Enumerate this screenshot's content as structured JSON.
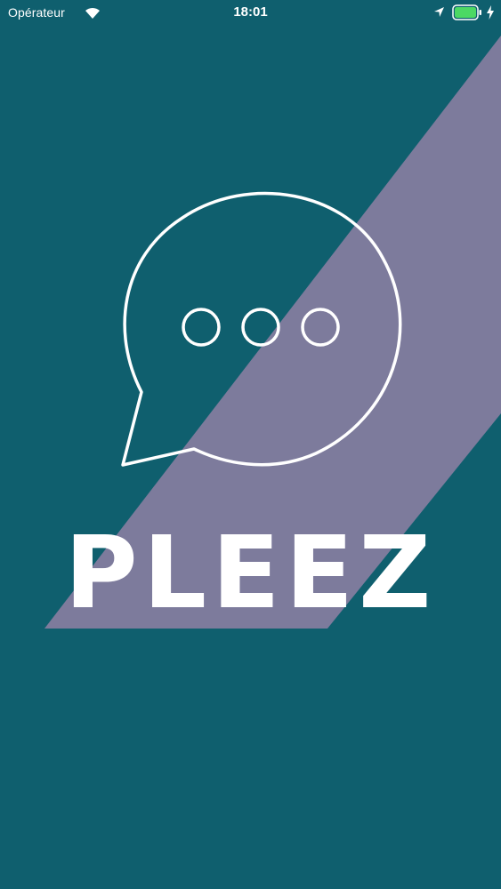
{
  "status_bar": {
    "carrier": "Opérateur",
    "time": "18:01",
    "icons": [
      "wifi-icon",
      "location-icon",
      "battery-icon",
      "charging-icon"
    ]
  },
  "splash": {
    "brand_name": "PLEEZ",
    "logo_icon": "chat-bubble-icon"
  },
  "colors": {
    "background": "#0f5f6e",
    "stripe": "#7d7b9c",
    "foreground": "#ffffff",
    "battery": "#4cd964"
  }
}
